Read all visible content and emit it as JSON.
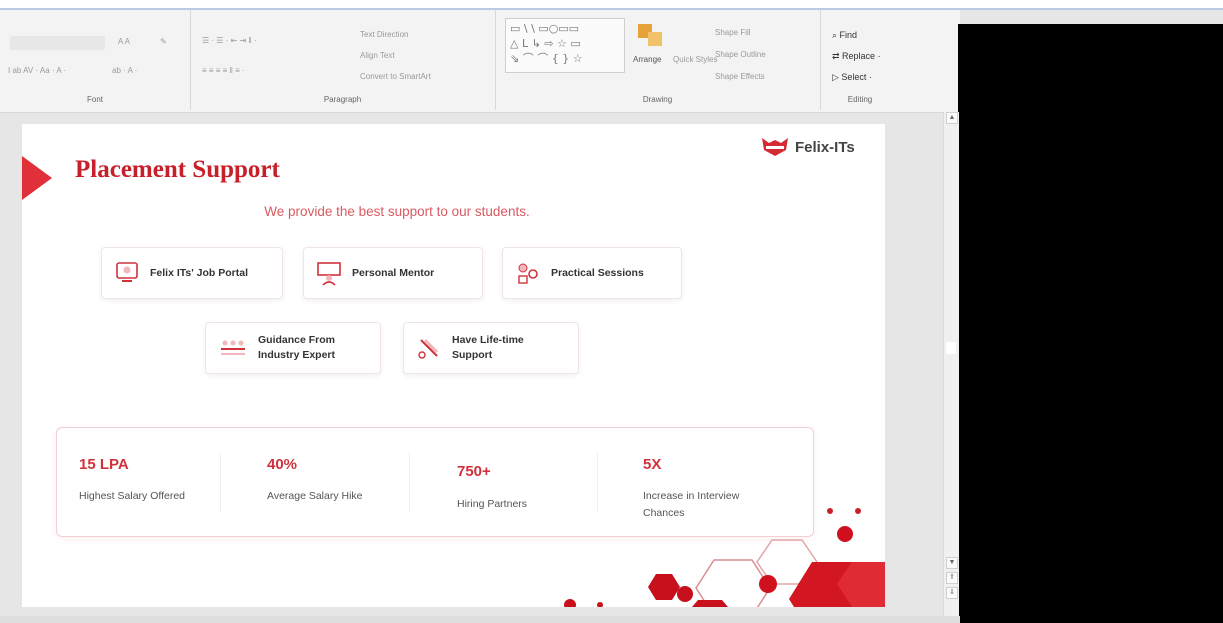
{
  "ribbon": {
    "groups": [
      "Font",
      "Paragraph",
      "Drawing",
      "Editing"
    ],
    "paragraph_items": [
      "Text Direction",
      "Align Text",
      "Convert to SmartArt"
    ],
    "drawing_items": [
      "Arrange",
      "Quick Styles",
      "Shape Fill",
      "Shape Outline",
      "Shape Effects"
    ],
    "editing_items": [
      "Find",
      "Replace",
      "Select"
    ]
  },
  "slide": {
    "title": "Placement Support",
    "subtitle": "We provide the best support to our students.",
    "logo_text": "Felix-ITs",
    "features": [
      {
        "label": "Felix ITs' Job Portal",
        "icon": "portal-icon"
      },
      {
        "label": "Personal Mentor",
        "icon": "mentor-icon"
      },
      {
        "label": "Practical Sessions",
        "icon": "sessions-icon"
      },
      {
        "label": "Guidance From Industry Expert",
        "label_l1": "Guidance From",
        "label_l2": "Industry Expert",
        "icon": "expert-icon"
      },
      {
        "label": "Have Life-time Support",
        "label_l1": "Have Life-time",
        "label_l2": "Support",
        "icon": "support-icon"
      }
    ],
    "stats": [
      {
        "value": "15 LPA",
        "desc": "Highest Salary Offered"
      },
      {
        "value": "40%",
        "desc": "Average Salary Hike"
      },
      {
        "value": "750+",
        "desc": "Hiring Partners"
      },
      {
        "value": "5X",
        "desc": "Increase in Interview Chances"
      }
    ]
  },
  "colors": {
    "accent": "#c8202a",
    "accent_light": "#e0303a",
    "sidebar": "#000000"
  }
}
